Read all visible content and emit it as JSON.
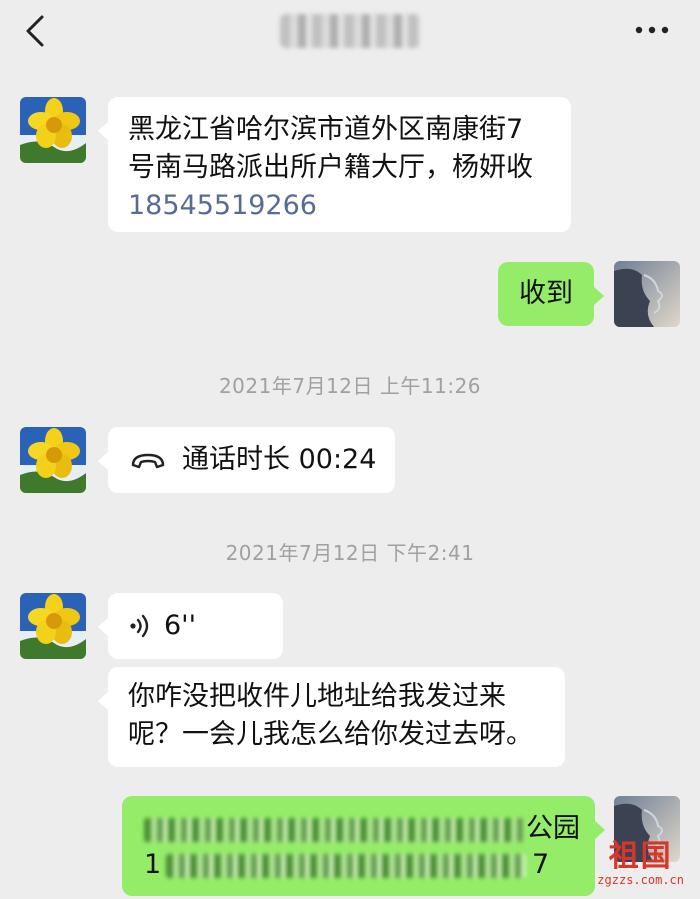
{
  "header": {
    "back_icon": "chevron-left-icon",
    "title": "",
    "more_icon": "more-dots-icon"
  },
  "messages": [
    {
      "side": "left",
      "type": "text",
      "lines": [
        "黑龙江省哈尔滨市道外区南康街7",
        "号南马路派出所户籍大厅，杨妍收"
      ],
      "phone": "18545519266"
    },
    {
      "side": "right",
      "type": "text",
      "text": "收到"
    },
    {
      "type": "timestamp",
      "text": "2021年7月12日 上午11:26"
    },
    {
      "side": "left",
      "type": "call",
      "icon": "phone-hangup-icon",
      "text": "通话时长 00:24"
    },
    {
      "type": "timestamp",
      "text": "2021年7月12日 下午2:41"
    },
    {
      "side": "left",
      "type": "voice",
      "icon": "voice-wave-icon",
      "duration": "6''"
    },
    {
      "side": "left",
      "type": "text",
      "lines": [
        "你咋没把收件儿地址给我发过来",
        "呢？一会儿我怎么给你发过去呀。"
      ]
    },
    {
      "side": "right",
      "type": "text",
      "visible_suffix": "公园",
      "visible_line2_prefix": "1",
      "visible_line2_suffix": "7"
    }
  ],
  "watermark": {
    "brand": "祖国",
    "url": "zgzzs.com.cn"
  },
  "colors": {
    "background": "#ededed",
    "sent_bubble": "#95ec69",
    "link": "#576b95",
    "watermark": "#d9362b"
  }
}
